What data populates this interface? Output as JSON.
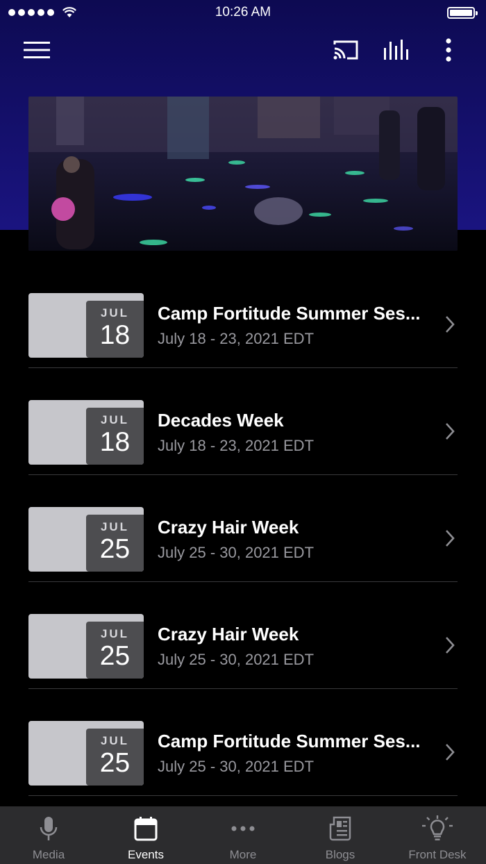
{
  "status_bar": {
    "time": "10:26 AM"
  },
  "toolbar": {
    "icons": [
      "menu-icon",
      "cast-icon",
      "equalizer-icon",
      "more-vertical-icon"
    ]
  },
  "colors": {
    "header": "#120e66",
    "background": "#000000",
    "thumb": "#c6c6cb",
    "badge": "#4d4d50",
    "subtext": "#9a9aa0",
    "tabbar": "#2c2c2e"
  },
  "events": [
    {
      "month": "JUL",
      "day": "18",
      "title": "Camp Fortitude Summer Ses...",
      "dates": "July 18 - 23, 2021 EDT"
    },
    {
      "month": "JUL",
      "day": "18",
      "title": "Decades Week",
      "dates": "July 18 - 23, 2021 EDT"
    },
    {
      "month": "JUL",
      "day": "25",
      "title": "Crazy Hair Week",
      "dates": "July 25 - 30, 2021 EDT"
    },
    {
      "month": "JUL",
      "day": "25",
      "title": "Crazy Hair Week",
      "dates": "July 25 - 30, 2021 EDT"
    },
    {
      "month": "JUL",
      "day": "25",
      "title": "Camp Fortitude Summer Ses...",
      "dates": "July 25 - 30, 2021 EDT"
    }
  ],
  "tabs": [
    {
      "label": "Media",
      "icon": "microphone-icon",
      "active": false
    },
    {
      "label": "Events",
      "icon": "calendar-icon",
      "active": true
    },
    {
      "label": "More",
      "icon": "more-horizontal-icon",
      "active": false
    },
    {
      "label": "Blogs",
      "icon": "newspaper-icon",
      "active": false
    },
    {
      "label": "Front Desk",
      "icon": "lightbulb-icon",
      "active": false
    }
  ]
}
